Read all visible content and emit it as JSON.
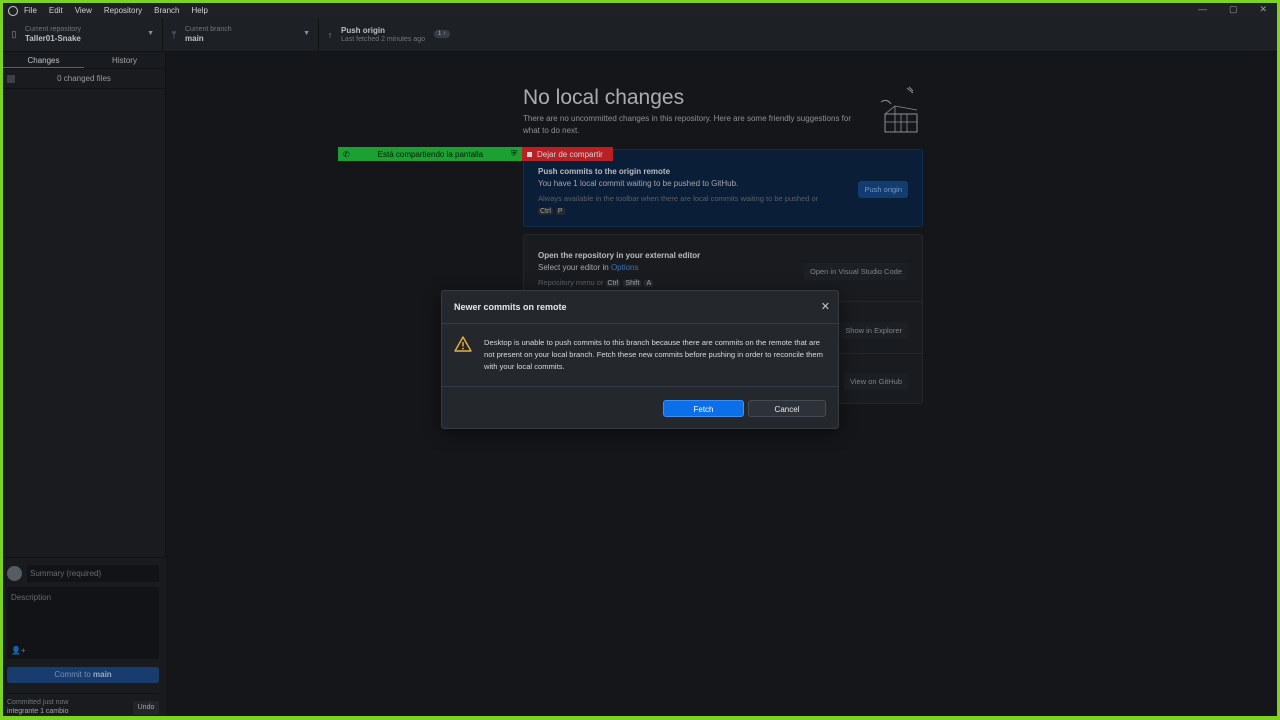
{
  "menubar": {
    "items": [
      "File",
      "Edit",
      "View",
      "Repository",
      "Branch",
      "Help"
    ],
    "window_controls": [
      "—",
      "▢",
      "✕"
    ]
  },
  "toolbar": {
    "repo_label": "Current repository",
    "repo_value": "Taller01-Snake",
    "branch_label": "Current branch",
    "branch_value": "main",
    "push_label": "Push origin",
    "push_sub": "Last fetched 2 minutes ago",
    "push_badge": "1 ↑"
  },
  "sidebar": {
    "tabs": [
      "Changes",
      "History"
    ],
    "changed_files": "0 changed files",
    "summary_placeholder": "Summary (required)",
    "description_placeholder": "Description",
    "commit_prefix": "Commit to ",
    "commit_branch": "main",
    "committed_line1": "Committed just now",
    "committed_line2": "integrante 1 cambio",
    "undo": "Undo"
  },
  "main": {
    "title": "No local changes",
    "subtitle": "There are no uncommitted changes in this repository. Here are some friendly suggestions for what to do next.",
    "push_card": {
      "title": "Push commits to the origin remote",
      "line": "You have 1 local commit waiting to be pushed to GitHub.",
      "hint": "Always available in the toolbar when there are local commits waiting to be pushed or",
      "keys": [
        "Ctrl",
        "P"
      ],
      "button": "Push origin"
    },
    "editor_card": {
      "title": "Open the repository in your external editor",
      "line_prefix": "Select your editor in ",
      "line_link": "Options",
      "hint": "Repository menu or",
      "keys": [
        "Ctrl",
        "Shift",
        "A"
      ],
      "button": "Open in Visual Studio Code"
    },
    "explorer_button": "Show in Explorer",
    "github_button": "View on GitHub"
  },
  "share_bar": {
    "sharing_text": "Está compartiendo la pantalla",
    "stop_text": "Dejar de compartir"
  },
  "dialog": {
    "title": "Newer commits on remote",
    "body": "Desktop is unable to push commits to this branch because there are commits on the remote that are not present on your local branch. Fetch these new commits before pushing in order to reconcile them with your local commits.",
    "fetch": "Fetch",
    "cancel": "Cancel"
  }
}
